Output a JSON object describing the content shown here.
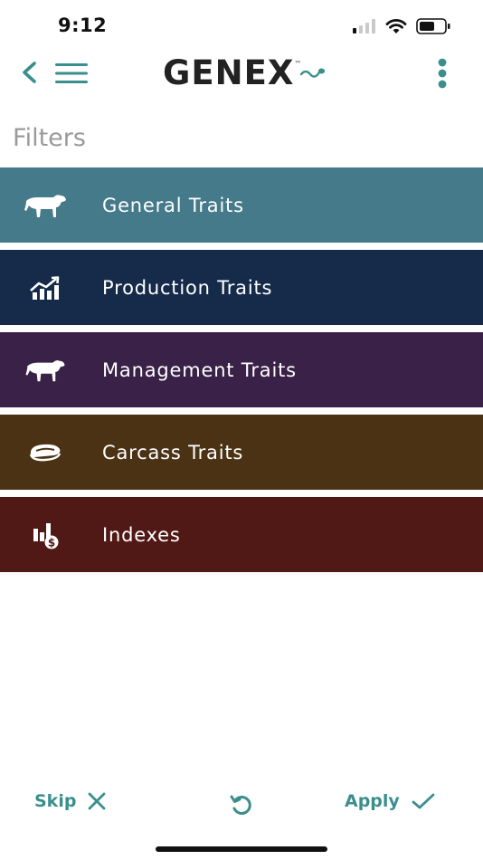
{
  "status_bar": {
    "time": "9:12"
  },
  "app_bar": {
    "logo_text": "GENEX",
    "logo_tm": "™"
  },
  "filters": {
    "title": "Filters",
    "items": [
      {
        "label": "General Traits",
        "color": "#447a89",
        "icon": "cow-icon"
      },
      {
        "label": "Production Traits",
        "color": "#162b4a",
        "icon": "trending-chart-icon"
      },
      {
        "label": "Management Traits",
        "color": "#3a2147",
        "icon": "cow-icon"
      },
      {
        "label": "Carcass Traits",
        "color": "#4b3214",
        "icon": "steak-icon"
      },
      {
        "label": "Indexes",
        "color": "#511915",
        "icon": "bar-chart-dollar-icon"
      }
    ]
  },
  "bottom_bar": {
    "skip_label": "Skip",
    "apply_label": "Apply"
  },
  "colors": {
    "accent": "#3a8f8c",
    "title_gray": "#9a9a9a"
  }
}
